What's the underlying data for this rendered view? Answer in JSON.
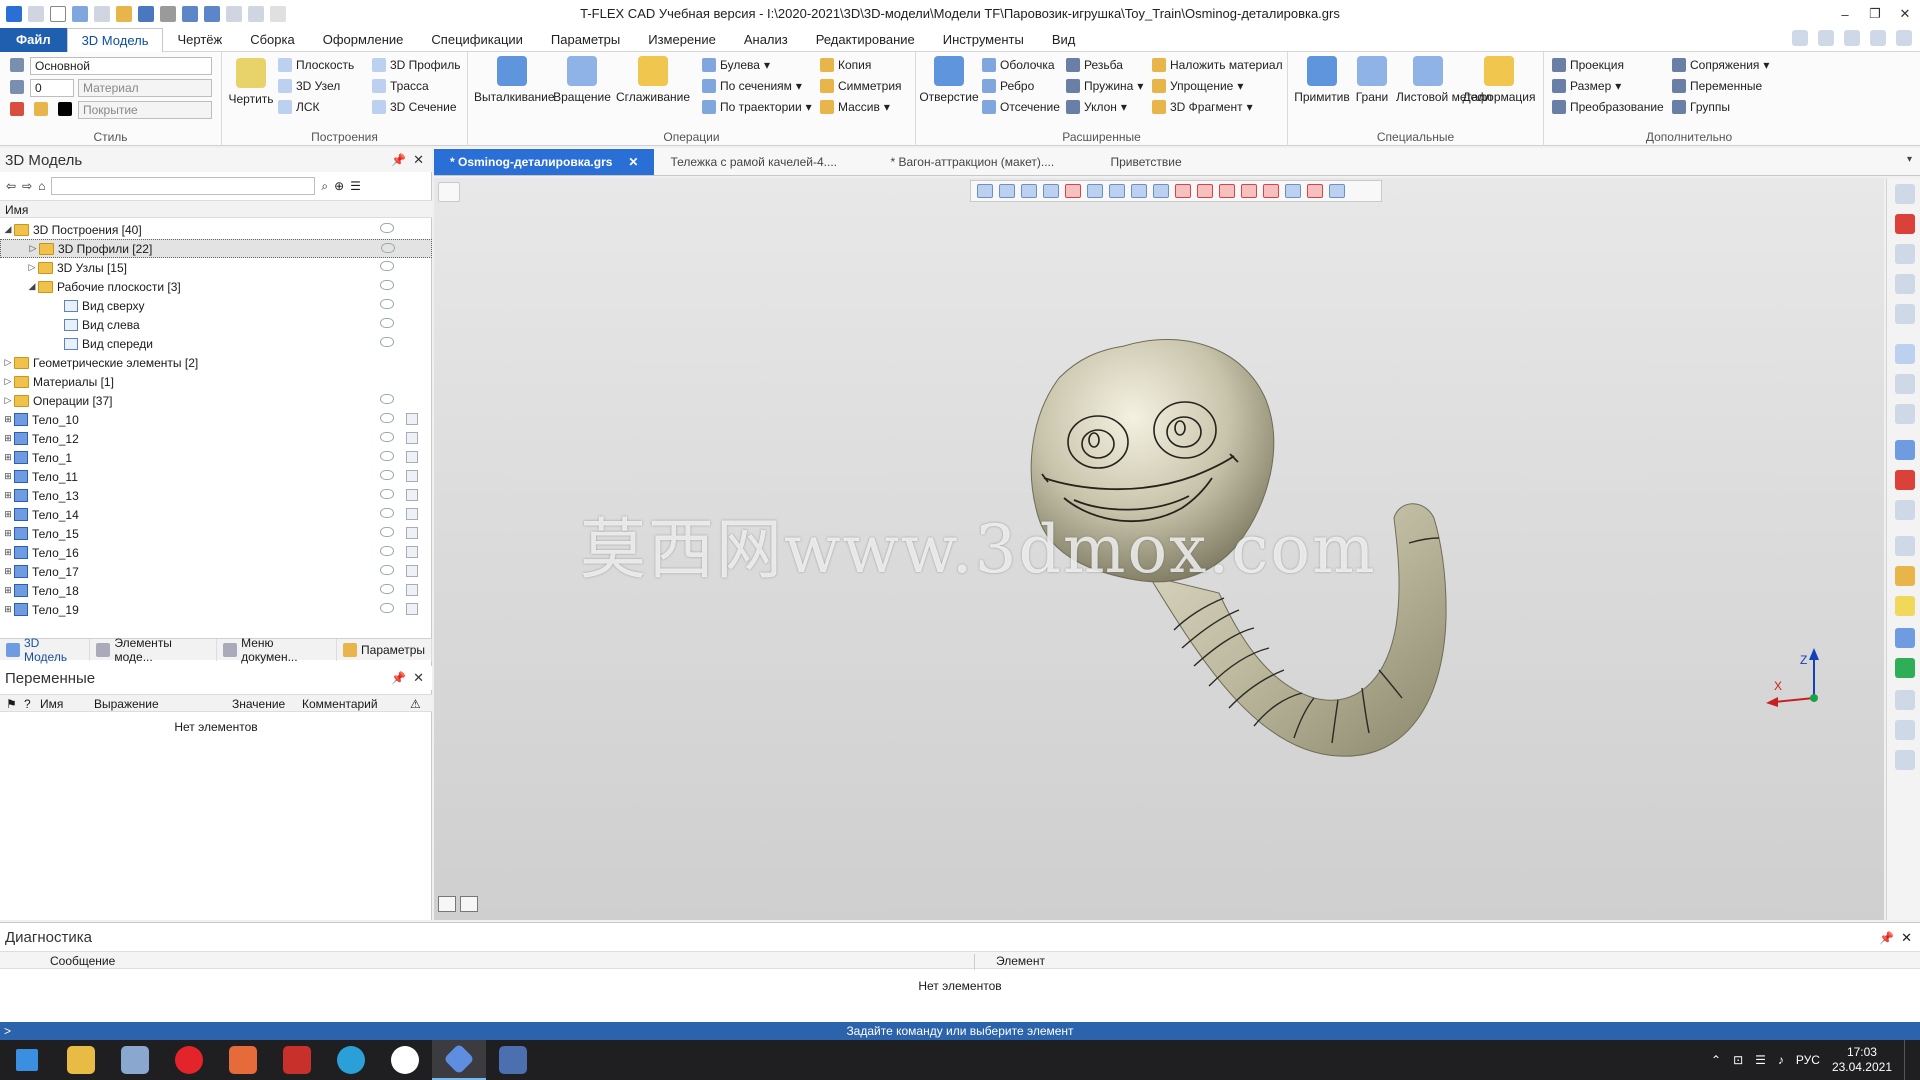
{
  "window": {
    "title": "T-FLEX CAD Учебная версия - I:\\2020-2021\\3D\\3D-модели\\Модели TF\\Паровозик-игрушка\\Toy_Train\\Osminog-деталировка.grs"
  },
  "menu": {
    "file": "Файл",
    "tabs": [
      "3D Модель",
      "Чертёж",
      "Сборка",
      "Оформление",
      "Спецификации",
      "Параметры",
      "Измерение",
      "Анализ",
      "Редактирование",
      "Инструменты",
      "Вид"
    ]
  },
  "ribbon": {
    "style": {
      "label": "Стиль",
      "layer": "Основной",
      "level": "0",
      "material": "Материал",
      "coating": "Покрытие"
    },
    "build": {
      "label": "Построения",
      "draw": "Чертить",
      "items": [
        "Плоскость",
        "3D Узел",
        "ЛСК",
        "3D Профиль",
        "Трасса",
        "3D Сечение"
      ]
    },
    "ops": {
      "label": "Операции",
      "big": [
        "Выталкивание",
        "Вращение",
        "Сглаживание"
      ],
      "items": [
        "Булева",
        "По сечениям",
        "По траектории",
        "Копия",
        "Симметрия",
        "Массив"
      ]
    },
    "ext": {
      "label": "Расширенные",
      "big": "Отверстие",
      "items": [
        "Оболочка",
        "Ребро",
        "Отсечение",
        "Резьба",
        "Пружина",
        "Уклон",
        "Наложить материал",
        "Упрощение",
        "3D Фрагмент"
      ]
    },
    "spec": {
      "label": "Специальные",
      "big": [
        "Примитив",
        "Грани",
        "Листовой металл",
        "Деформация"
      ]
    },
    "extra": {
      "label": "Дополнительно",
      "items": [
        "Проекция",
        "Размер",
        "Преобразование",
        "Сопряжения",
        "Переменные",
        "Группы"
      ]
    }
  },
  "model_panel": {
    "title": "3D Модель",
    "column": "Имя",
    "tree": [
      {
        "label": "3D Построения [40]",
        "level": 0,
        "expanded": true,
        "icon": "folder-icon"
      },
      {
        "label": "3D Профили [22]",
        "level": 1,
        "expanded": false,
        "icon": "folder-icon",
        "selected": true
      },
      {
        "label": "3D Узлы [15]",
        "level": 1,
        "expanded": false,
        "icon": "folder-icon"
      },
      {
        "label": "Рабочие плоскости [3]",
        "level": 1,
        "expanded": true,
        "icon": "folder-icon"
      },
      {
        "label": "Вид сверху",
        "level": 2,
        "icon": "plane-icon"
      },
      {
        "label": "Вид слева",
        "level": 2,
        "icon": "plane-icon"
      },
      {
        "label": "Вид спереди",
        "level": 2,
        "icon": "plane-icon"
      },
      {
        "label": "Геометрические элементы [2]",
        "level": 0,
        "expanded": false,
        "icon": "folder-icon"
      },
      {
        "label": "Материалы [1]",
        "level": 0,
        "expanded": false,
        "icon": "folder-icon"
      },
      {
        "label": "Операции [37]",
        "level": 0,
        "expanded": false,
        "icon": "folder-icon"
      },
      {
        "label": "Тело_10",
        "level": 0,
        "icon": "body-icon"
      },
      {
        "label": "Тело_12",
        "level": 0,
        "icon": "body-icon"
      },
      {
        "label": "Тело_1",
        "level": 0,
        "icon": "body-icon"
      },
      {
        "label": "Тело_11",
        "level": 0,
        "icon": "body-icon"
      },
      {
        "label": "Тело_13",
        "level": 0,
        "icon": "body-icon"
      },
      {
        "label": "Тело_14",
        "level": 0,
        "icon": "body-icon"
      },
      {
        "label": "Тело_15",
        "level": 0,
        "icon": "body-icon"
      },
      {
        "label": "Тело_16",
        "level": 0,
        "icon": "body-icon"
      },
      {
        "label": "Тело_17",
        "level": 0,
        "icon": "body-icon"
      },
      {
        "label": "Тело_18",
        "level": 0,
        "icon": "body-icon"
      },
      {
        "label": "Тело_19",
        "level": 0,
        "icon": "body-icon"
      }
    ],
    "tabs": [
      "3D Модель",
      "Элементы моде...",
      "Меню докумен...",
      "Параметры"
    ]
  },
  "variables_panel": {
    "title": "Переменные",
    "columns": [
      "?",
      "Имя",
      "Выражение",
      "Значение",
      "Комментарий"
    ],
    "empty": "Нет элементов"
  },
  "documents": {
    "tabs": [
      "* Osminog-деталировка.grs",
      "Тележка с рамой качелей-4....",
      "* Вагон-аттракцион (макет)....",
      "Приветствие"
    ]
  },
  "viewport": {
    "watermark": "莫西网www.3dmox.com",
    "axes": {
      "x": "X",
      "z": "Z"
    }
  },
  "diagnostics": {
    "title": "Диагностика",
    "columns": [
      "Сообщение",
      "Элемент"
    ],
    "empty": "Нет элементов"
  },
  "status": {
    "text": "Задайте команду или выберите элемент",
    "prompt": ">"
  },
  "taskbar": {
    "lang": "РУС",
    "time": "17:03",
    "date": "23.04.2021"
  },
  "colors": {
    "accent": "#2a6fd6",
    "status": "#2c63ad",
    "file_tab": "#1f5fb0"
  }
}
